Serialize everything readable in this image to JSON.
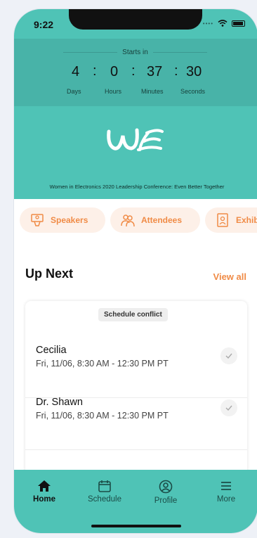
{
  "status_bar": {
    "time": "9:22"
  },
  "countdown": {
    "heading": "Starts in",
    "units": [
      {
        "value": "4",
        "label": "Days"
      },
      {
        "value": "0",
        "label": "Hours"
      },
      {
        "value": "37",
        "label": "Minutes"
      },
      {
        "value": "30",
        "label": "Seconds"
      }
    ],
    "separator": ":"
  },
  "event": {
    "title": "Women in Electronics 2020 Leadership Conference: Even Better Together"
  },
  "quick_links": [
    {
      "label": "Speakers",
      "icon": "speaker-podium-icon"
    },
    {
      "label": "Attendees",
      "icon": "people-icon"
    },
    {
      "label": "Exhib",
      "icon": "exhibitor-badge-icon"
    }
  ],
  "up_next": {
    "heading": "Up Next",
    "view_all": "View all",
    "conflict_badge": "Schedule conflict",
    "sessions": [
      {
        "name": "Cecilia",
        "time": "Fri, 11/06, 8:30 AM - 12:30 PM PT"
      },
      {
        "name": "Dr. Shawn",
        "time": "Fri, 11/06, 8:30 AM - 12:30 PM PT"
      }
    ]
  },
  "tab_bar": {
    "tabs": [
      {
        "label": "Home",
        "icon": "home-icon",
        "active": true
      },
      {
        "label": "Schedule",
        "icon": "calendar-icon"
      },
      {
        "label": "Profile",
        "icon": "user-icon"
      },
      {
        "label": "More",
        "icon": "hamburger-menu-icon"
      }
    ]
  },
  "colors": {
    "teal": "#4fc3b6",
    "teal_dark": "#48b3a8",
    "accent_orange": "#f08b46",
    "pill_bg": "#fdf0e8"
  }
}
